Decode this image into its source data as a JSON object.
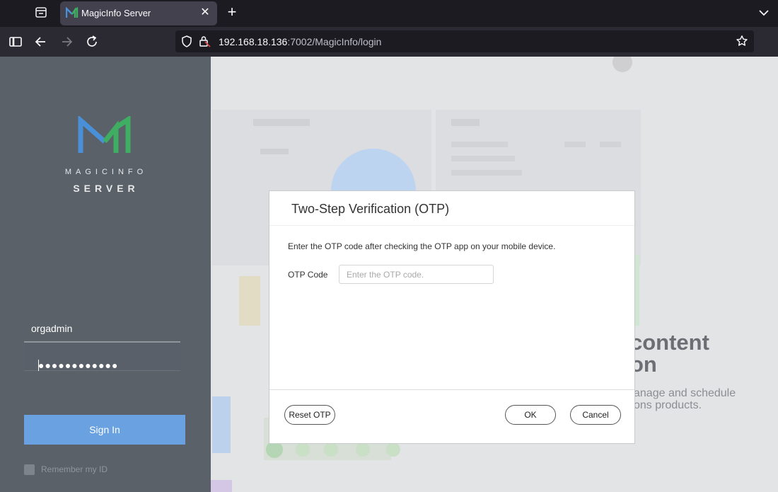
{
  "browser": {
    "tab_title": "MagicInfo Server",
    "tab_close": "✕",
    "new_tab": "+",
    "url_host": "192.168.18.136",
    "url_rest": ":7002/MagicInfo/login"
  },
  "sidebar": {
    "logo_line1": "MAGICINFO",
    "logo_line2": "SERVER",
    "username": "orgadmin",
    "password_mask": "●●●●●●●●●●●●",
    "signin_label": "Sign In",
    "remember_label": "Remember my ID",
    "remember_checked": false
  },
  "background": {
    "headline1": "content",
    "headline2": "on",
    "sub1": "anage and schedule",
    "sub2": "ons products."
  },
  "modal": {
    "title": "Two-Step Verification (OTP)",
    "description": "Enter the OTP code after checking the OTP app on your mobile device.",
    "otp_label": "OTP Code",
    "otp_value": "",
    "otp_placeholder": "Enter the OTP code.",
    "reset_label": "Reset OTP",
    "ok_label": "OK",
    "cancel_label": "Cancel"
  },
  "colors": {
    "sidebar_bg": "#5a6168",
    "signin_bg": "#6aa2e1",
    "logo_blue": "#4a90d9",
    "logo_green": "#3fae63"
  }
}
